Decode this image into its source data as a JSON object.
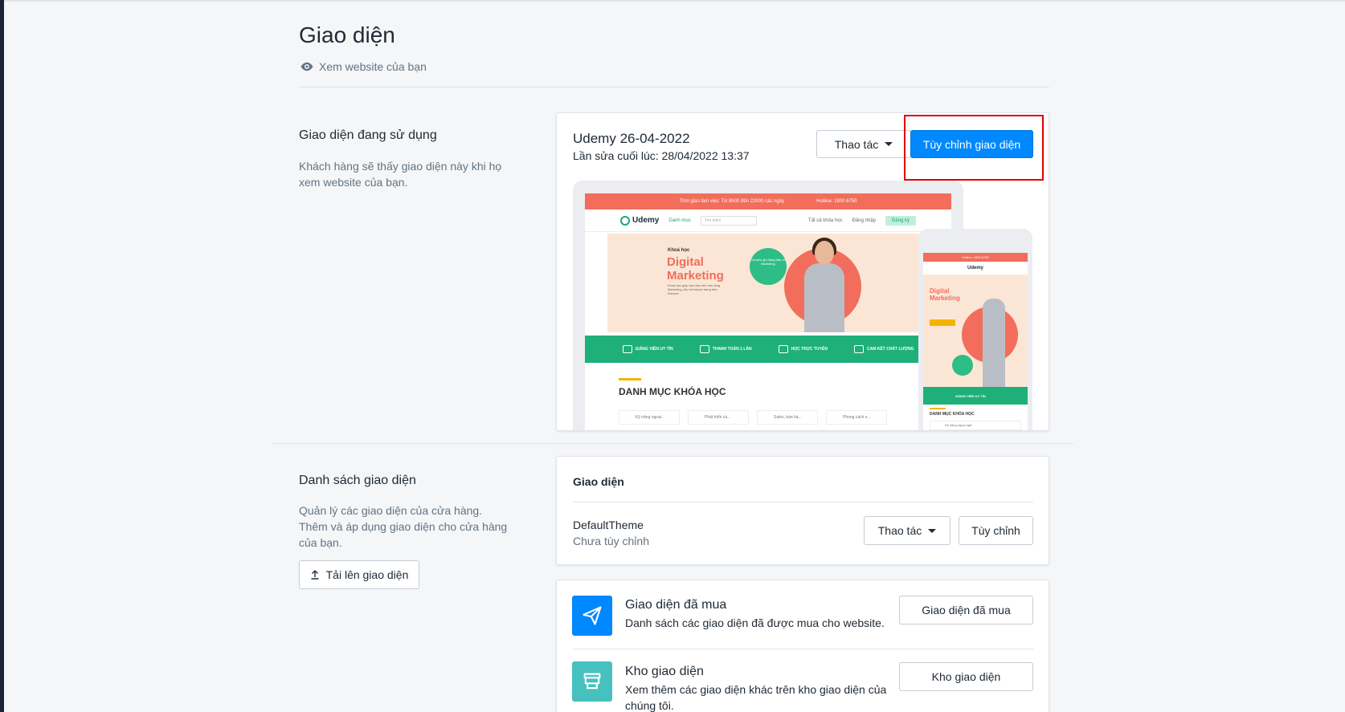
{
  "page": {
    "title": "Giao diện",
    "view_link": "Xem website của bạn"
  },
  "current": {
    "section_title": "Giao diện đang sử dụng",
    "section_desc_1": "Khách hàng sẽ thấy giao diện này khi họ",
    "section_desc_2": "xem website của bạn.",
    "theme_name": "Udemy 26-04-2022",
    "last_edited": "Lần sửa cuối lúc: 28/04/2022 13:37",
    "actions_label": "Thao tác",
    "customize_label": "Tùy chỉnh giao diện"
  },
  "preview": {
    "topbar_hours": "Thời gian làm việc: Từ 8h00 đến 22h00 các ngày",
    "topbar_hotline": "Hotline: 1800 6750",
    "logo": "Udemy",
    "nav_category": "Danh mục",
    "search_placeholder": "Tìm kiếm",
    "all_courses": "Tất cả khóa học",
    "login": "Đăng nhập",
    "register": "Đăng ký",
    "hero_small": "Khoá học",
    "hero_line1": "Digital",
    "hero_line2": "Marketing",
    "hero_sub": "Khóa học giúp bạn làm chủ nền tảng Marketing, thu hút khách hàng trên Internet",
    "bubble": "Chuyên gia hàng đầu về Marketing",
    "features": [
      "GIẢNG VIÊN UY TÍN",
      "THANH TOÁN 1 LẦN",
      "HỌC TRỰC TUYẾN",
      "CAM KẾT CHẤT LƯỢNG"
    ],
    "category_heading": "DANH MỤC KHÓA HỌC",
    "categories": [
      "Kỹ năng ngoại...",
      "Phát triển cá...",
      "Sales, bán hà...",
      "Phong cách s..."
    ],
    "phone_hotline": "Hotline: 1800 6750",
    "phone_feature": "GIẢNG VIÊN UY TÍN",
    "phone_category_heading": "DANH MỤC KHÓA HỌC",
    "phone_category": "Kỹ năng ngoại ngữ"
  },
  "themes": {
    "section_title": "Danh sách giao diện",
    "desc_1": "Quản lý các giao diện của cửa hàng.",
    "desc_2": "Thêm và áp dụng giao diện cho cửa hàng",
    "desc_3": "của bạn.",
    "upload_label": "Tải lên giao diện",
    "list_header": "Giao diện",
    "default_name": "DefaultTheme",
    "default_status": "Chưa tùy chỉnh",
    "actions_label": "Thao tác",
    "customize_label": "Tùy chỉnh"
  },
  "purchased": {
    "title": "Giao diện đã mua",
    "desc": "Danh sách các giao diện đã được mua cho website.",
    "button": "Giao diện đã mua",
    "icon_color": "#0088ff"
  },
  "store": {
    "title": "Kho giao diện",
    "desc_1": "Xem thêm các giao diện khác trên kho giao diện của",
    "desc_2": "chúng tôi.",
    "button": "Kho giao diện",
    "icon_color": "#47c1bf"
  }
}
